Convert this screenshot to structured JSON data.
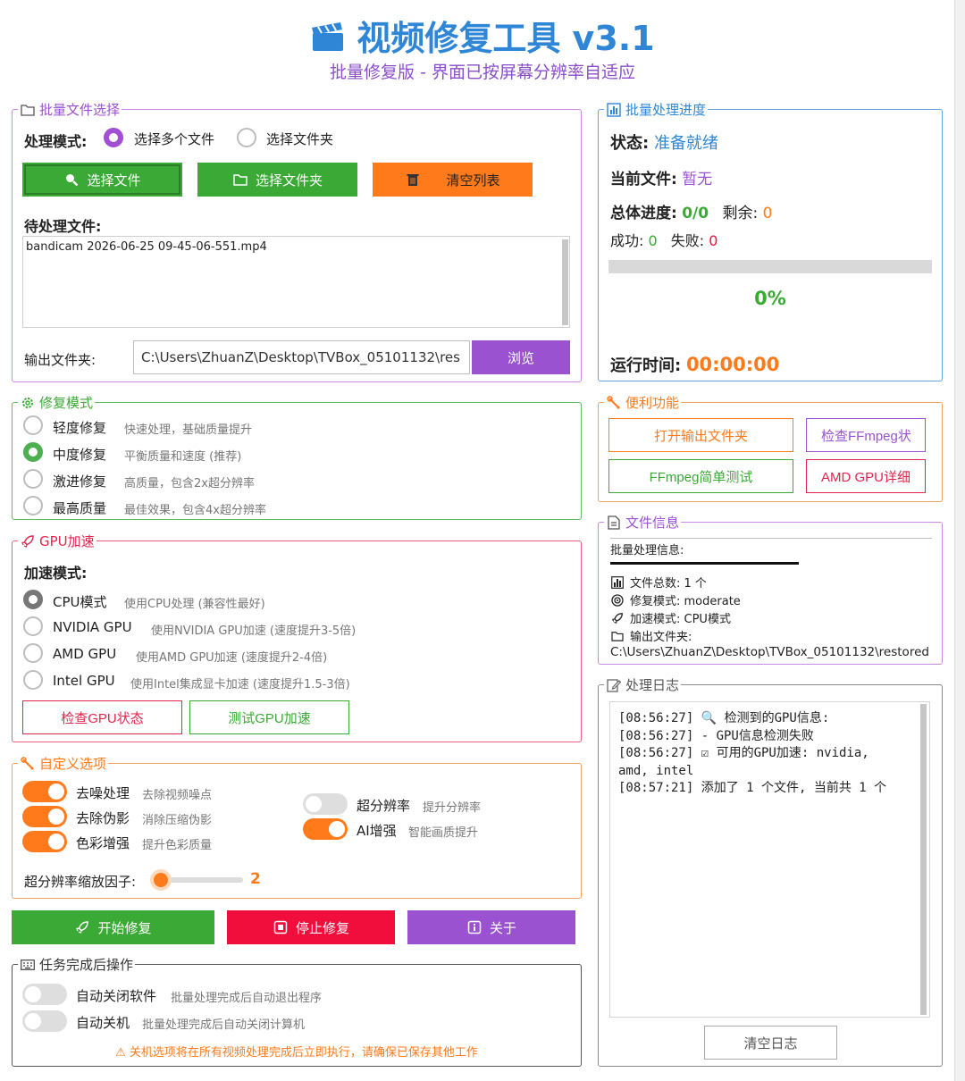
{
  "header": {
    "title": "视频修复工具 v3.1",
    "subtitle": "批量修复版 - 界面已按屏幕分辨率自适应"
  },
  "batch_files": {
    "legend": "批量文件选择",
    "mode_label": "处理模式:",
    "mode_options": [
      "选择多个文件",
      "选择文件夹"
    ],
    "mode_selected": "选择多个文件",
    "btn_select_files": "选择文件",
    "btn_select_folder": "选择文件夹",
    "btn_clear_list": "清空列表",
    "pending_label": "待处理文件:",
    "pending_files": [
      "bandicam 2026-06-25 09-45-06-551.mp4"
    ],
    "output_label": "输出文件夹:",
    "output_value": "C:\\Users\\ZhuanZ\\Desktop\\TVBox_05101132\\res",
    "btn_browse": "浏览"
  },
  "repair_mode": {
    "legend": "修复模式",
    "options": [
      {
        "label": "轻度修复",
        "desc": "快速处理，基础质量提升",
        "selected": false
      },
      {
        "label": "中度修复",
        "desc": "平衡质量和速度 (推荐)",
        "selected": true
      },
      {
        "label": "激进修复",
        "desc": "高质量，包含2x超分辨率",
        "selected": false
      },
      {
        "label": "最高质量",
        "desc": "最佳效果，包含4x超分辨率",
        "selected": false
      }
    ]
  },
  "gpu": {
    "legend": "GPU加速",
    "mode_label": "加速模式:",
    "options": [
      {
        "label": "CPU模式",
        "desc": "使用CPU处理 (兼容性最好)",
        "selected": true
      },
      {
        "label": "NVIDIA GPU",
        "desc": "使用NVIDIA GPU加速 (速度提升3-5倍)",
        "selected": false
      },
      {
        "label": "AMD GPU",
        "desc": "使用AMD GPU加速 (速度提升2-4倍)",
        "selected": false
      },
      {
        "label": "Intel GPU",
        "desc": "使用Intel集成显卡加速 (速度提升1.5-3倍)",
        "selected": false
      }
    ],
    "btn_check": "检查GPU状态",
    "btn_test": "测试GPU加速"
  },
  "custom": {
    "legend": "自定义选项",
    "toggles_left": [
      {
        "label": "去噪处理",
        "desc": "去除视频噪点",
        "on": true
      },
      {
        "label": "去除伪影",
        "desc": "消除压缩伪影",
        "on": true
      },
      {
        "label": "色彩增强",
        "desc": "提升色彩质量",
        "on": true
      }
    ],
    "toggles_right": [
      {
        "label": "超分辨率",
        "desc": "提升分辨率",
        "on": false
      },
      {
        "label": "AI增强",
        "desc": "智能画质提升",
        "on": true
      }
    ],
    "scale_label": "超分辨率缩放因子:",
    "scale_value": "2",
    "scale_fraction": 0.0
  },
  "actions": {
    "start": "开始修复",
    "stop": "停止修复",
    "about": "关于"
  },
  "after_task": {
    "legend": "任务完成后操作",
    "options": [
      {
        "label": "自动关闭软件",
        "desc": "批量处理完成后自动退出程序",
        "on": false
      },
      {
        "label": "自动关机",
        "desc": "批量处理完成后自动关闭计算机",
        "on": false
      }
    ],
    "warning": "关机选项将在所有视频处理完成后立即执行，请确保已保存其他工作"
  },
  "progress": {
    "legend": "批量处理进度",
    "status_label": "状态:",
    "status_value": "准备就绪",
    "current_label": "当前文件:",
    "current_value": "暂无",
    "total_label": "总体进度:",
    "total_value": "0/0",
    "remaining_label": "剩余:",
    "remaining_value": "0",
    "success_label": "成功:",
    "success_value": "0",
    "fail_label": "失败:",
    "fail_value": "0",
    "percent_text": "0%",
    "percent_fraction": 0,
    "runtime_label": "运行时间:",
    "runtime_value": "00:00:00"
  },
  "utilities": {
    "legend": "便利功能",
    "btn_open_output": "打开输出文件夹",
    "btn_check_ffmpeg": "检查FFmpeg状",
    "btn_ffmpeg_test": "FFmpeg简单测试",
    "btn_amd_detail": "AMD GPU详细"
  },
  "file_info": {
    "legend": "文件信息",
    "heading": "批量处理信息:",
    "lines": [
      {
        "icon": "bar-chart-icon",
        "text": "文件总数: 1 个"
      },
      {
        "icon": "target-icon",
        "text": "修复模式: moderate"
      },
      {
        "icon": "rocket-icon",
        "text": "加速模式: CPU模式"
      },
      {
        "icon": "folder-icon",
        "text": "输出文件夹:"
      }
    ],
    "path": "C:\\Users\\ZhuanZ\\Desktop\\TVBox_05101132\\restored"
  },
  "log": {
    "legend": "处理日志",
    "lines": [
      "[08:56:27] 🔍 检测到的GPU信息:",
      "[08:56:27]   - GPU信息检测失败",
      "[08:56:27] ☑ 可用的GPU加速: nvidia,",
      "amd, intel",
      "[08:57:21] 添加了 1 个文件, 当前共 1 个"
    ],
    "btn_clear": "清空日志"
  },
  "colors": {
    "accent_blue": "#2f86d6",
    "purple": "#9a52d0",
    "green": "#3aa935",
    "orange": "#ff7a1a",
    "red": "#f10d3c"
  }
}
